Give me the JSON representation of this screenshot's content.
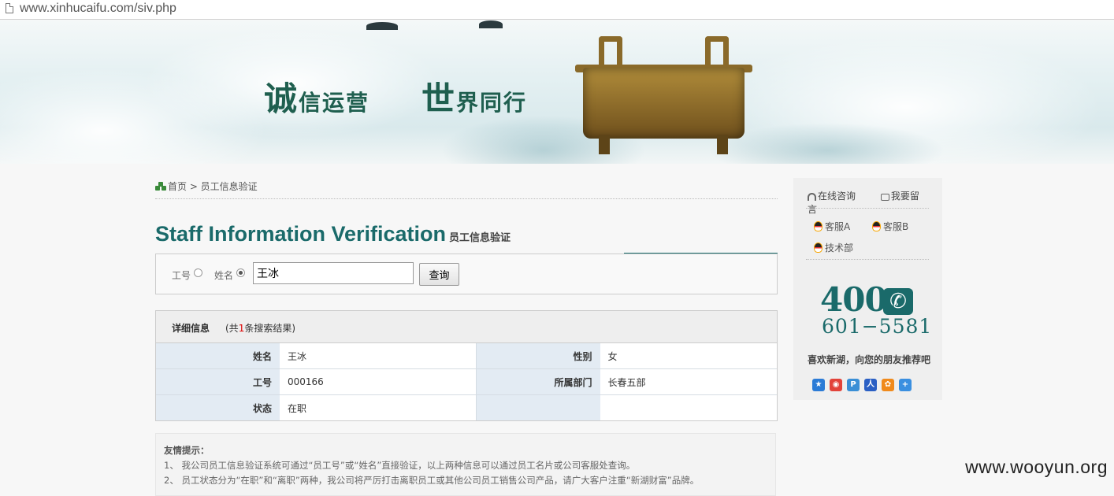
{
  "browser": {
    "url": "www.xinhucaifu.com/siv.php"
  },
  "banner": {
    "slogan_1_big": "诚",
    "slogan_1_rest": "信运营",
    "slogan_2_big": "世",
    "slogan_2_rest": "界同行"
  },
  "breadcrumb": {
    "text": "首页 > 员工信息验证"
  },
  "page": {
    "title_en": "Staff Information Verification",
    "title_zh": "员工信息验证"
  },
  "search": {
    "radio_id_label": "工号",
    "radio_name_label": "姓名",
    "selected": "姓名",
    "value": "王冰",
    "button_label": "查询"
  },
  "result": {
    "heading": "详细信息",
    "count_prefix": "(共",
    "count": "1",
    "count_suffix": "条搜索结果)",
    "rows": [
      {
        "k1": "姓名",
        "v1": "王冰",
        "k2": "性别",
        "v2": "女"
      },
      {
        "k1": "工号",
        "v1": "000166",
        "k2": "所属部门",
        "v2": "长春五部"
      },
      {
        "k1": "状态",
        "v1": "在职",
        "k2": "",
        "v2": ""
      }
    ]
  },
  "tips": {
    "title": "友情提示：",
    "line1": "1、 我公司员工信息验证系统可通过“员工号”或“姓名”直接验证，以上两种信息可以通过员工名片或公司客服处查询。",
    "line2": "2、 员工状态分为“在职”和“离职”两种，我公司将严厉打击离职员工或其他公司员工销售公司产品，请广大客户注重“新湖财富”品牌。"
  },
  "sidebar": {
    "online_consult": "在线咨询",
    "leave_message": "我要留言",
    "service_a": "客服A",
    "service_b": "客服B",
    "tech": "技术部",
    "hotline_1": "400",
    "hotline_2": "601−5581",
    "share_title": "喜欢新湖，向您的朋友推荐吧"
  },
  "watermark": "www.wooyun.org"
}
